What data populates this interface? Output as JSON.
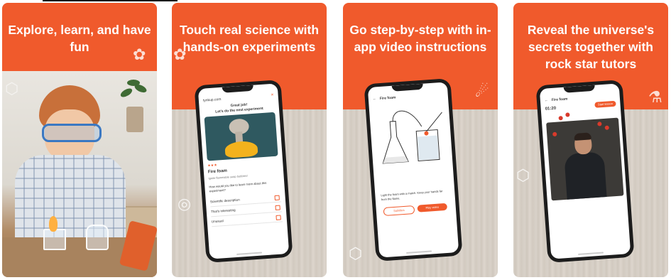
{
  "panels": [
    {
      "headline": "Explore, learn, and have fun"
    },
    {
      "headline": "Touch real science with hands-on experiments",
      "phone": {
        "brand": "tynkup.com",
        "greeting_line1": "Great job!",
        "greeting_line2": "Let's do the next experiment",
        "rating_note": "★★★",
        "experiment_name": "Fire foam",
        "experiment_sub": "Ignite flammable soap bubbles!",
        "prompt": "How would you like to learn more about this experiment?",
        "options": [
          "Scientific description",
          "That's interesting",
          "Unusual"
        ]
      }
    },
    {
      "headline": "Go step-by-step with in-app video instructions",
      "phone": {
        "screen_title": "Fire foam",
        "instruction": "Light the foam with a match. Keep your hands far from the flame.",
        "btn_secondary": "Subtitles",
        "btn_primary": "Play video"
      }
    },
    {
      "headline": "Reveal the universe's secrets together with rock star tutors",
      "phone": {
        "screen_title": "Fire foam",
        "timer": "01:20",
        "live_label": "Start lesson"
      }
    }
  ],
  "colors": {
    "brand_orange": "#f05a2c",
    "wood": "#d9d2c9",
    "white": "#ffffff"
  }
}
